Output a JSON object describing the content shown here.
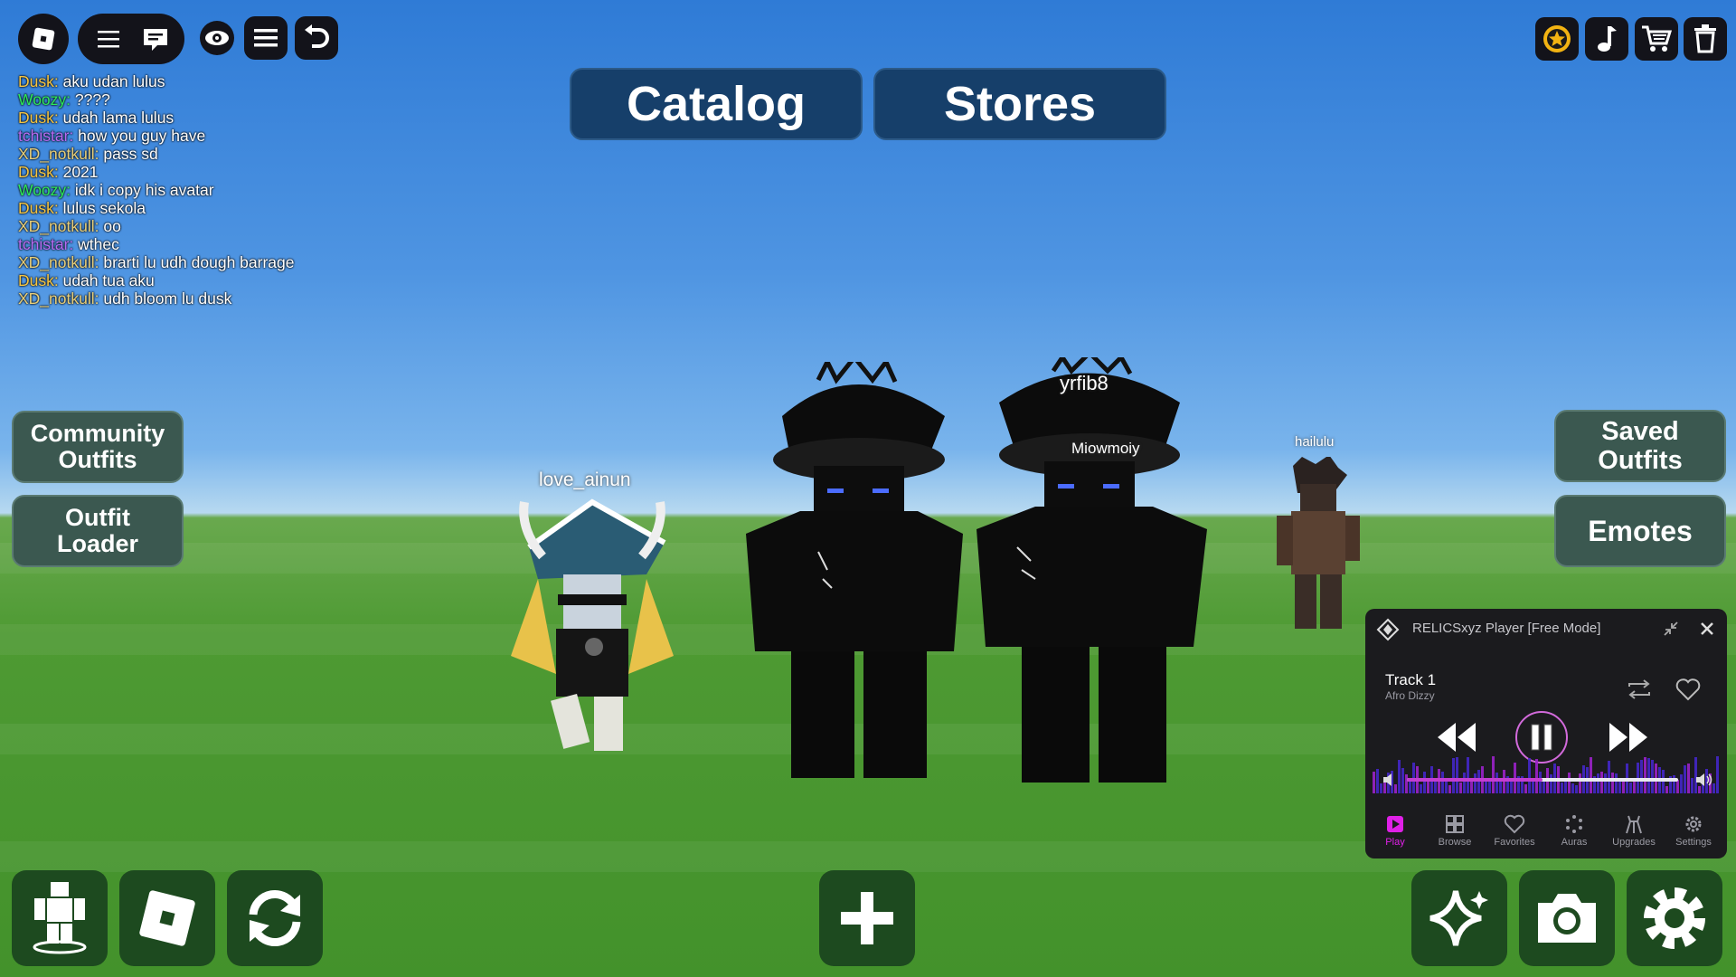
{
  "top_bar": {
    "buttons": [
      "roblox-menu",
      "hamburger",
      "chat",
      "visibility",
      "list",
      "undo"
    ]
  },
  "top_right_icons": [
    "star-coin",
    "music",
    "cart",
    "trash"
  ],
  "tabs": {
    "catalog": "Catalog",
    "stores": "Stores"
  },
  "chat": {
    "messages": [
      {
        "user": "Dusk:",
        "color": "#f5c542",
        "text": "aku udan lulus"
      },
      {
        "user": "Woozy:",
        "color": "#2ee85c",
        "text": "????"
      },
      {
        "user": "Dusk:",
        "color": "#f5c542",
        "text": "udah lama lulus"
      },
      {
        "user": "tchistar:",
        "color": "#b76cf5",
        "text": "how you guy have"
      },
      {
        "user": "XD_notkull:",
        "color": "#e8cf7a",
        "text": "pass sd"
      },
      {
        "user": "Dusk:",
        "color": "#f5c542",
        "text": "2021"
      },
      {
        "user": "Woozy:",
        "color": "#2ee85c",
        "text": "idk i copy his avatar"
      },
      {
        "user": "Dusk:",
        "color": "#f5c542",
        "text": "lulus sekola"
      },
      {
        "user": "XD_notkull:",
        "color": "#e8cf7a",
        "text": "oo"
      },
      {
        "user": "tchistar:",
        "color": "#b76cf5",
        "text": "wthec"
      },
      {
        "user": "XD_notkull:",
        "color": "#e8cf7a",
        "text": "brarti lu udh dough barrage"
      },
      {
        "user": "Dusk:",
        "color": "#f5c542",
        "text": "udah tua aku"
      },
      {
        "user": "XD_notkull:",
        "color": "#e8cf7a",
        "text": "udh bloom lu dusk"
      }
    ]
  },
  "left_buttons": {
    "community_outfits": "Community\nOutfits",
    "outfit_loader": "Outfit\nLoader"
  },
  "right_buttons": {
    "saved_outfits": "Saved\nOutfits",
    "emotes": "Emotes"
  },
  "nametags": {
    "player1": "love_ainun",
    "player2": "yrfib8",
    "player2_sub": "Miowmoiy",
    "player3": "hailulu"
  },
  "music_player": {
    "title": "RELICSxyz Player [Free Mode]",
    "track": "Track 1",
    "artist": "Afro Dizzy",
    "volume_fraction": 0.5,
    "tabs": [
      "Play",
      "Browse",
      "Favorites",
      "Auras",
      "Upgrades",
      "Settings"
    ],
    "accent": "#e020e8"
  },
  "bottom_buttons": [
    "avatar",
    "roblox",
    "refresh",
    "add",
    "sparkle",
    "camera",
    "settings"
  ]
}
